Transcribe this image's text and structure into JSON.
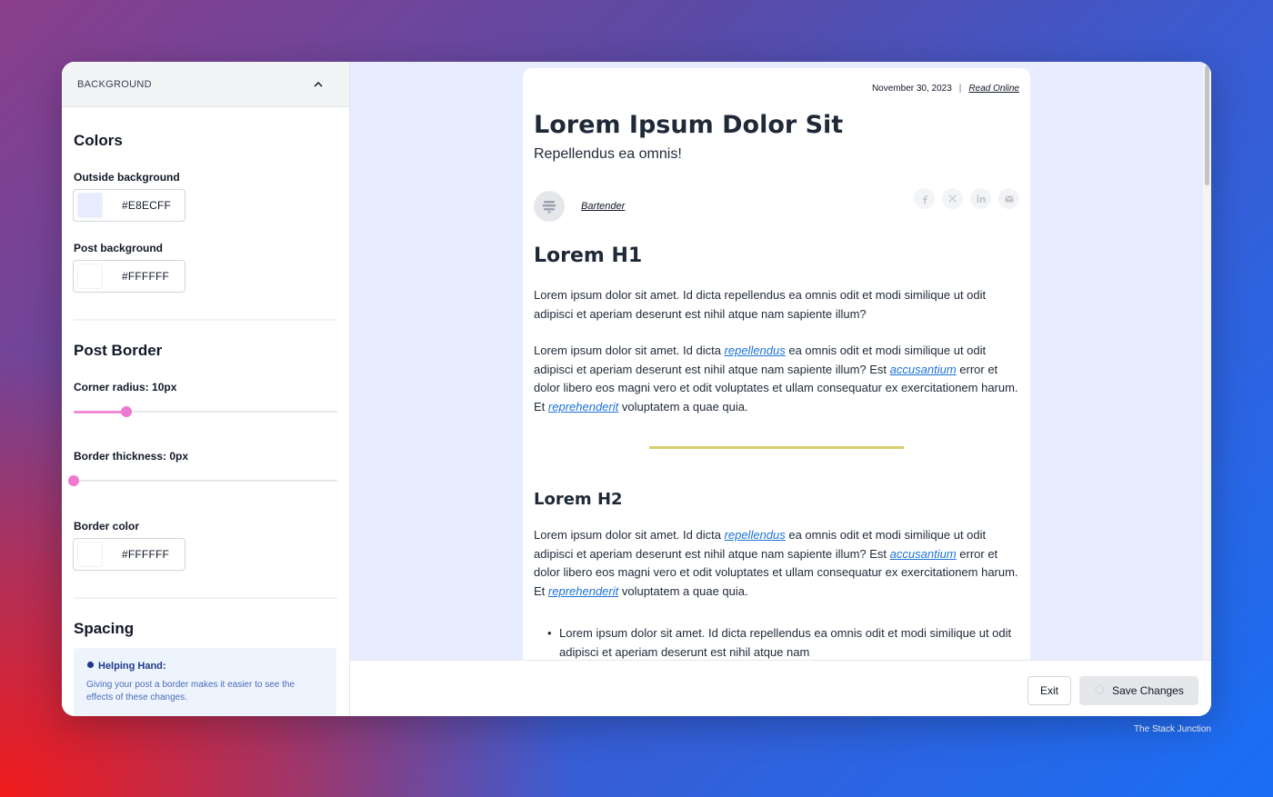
{
  "sidebar": {
    "section_label": "BACKGROUND",
    "colors": {
      "title": "Colors",
      "outside_label": "Outside background",
      "outside_value": "#E8ECFF",
      "post_label": "Post background",
      "post_value": "#FFFFFF"
    },
    "border": {
      "title": "Post Border",
      "radius_label": "Corner radius: 10px",
      "radius_fraction": 0.2,
      "thickness_label": "Border thickness: 0px",
      "thickness_fraction": 0.0,
      "color_label": "Border color",
      "color_value": "#FFFFFF"
    },
    "spacing": {
      "title": "Spacing",
      "helper_title": "Helping Hand:",
      "helper_text": "Giving your post a border makes it easier to see the effects of these changes."
    }
  },
  "post": {
    "date": "November 30, 2023",
    "separator": "|",
    "read_online": "Read Online",
    "title": "Lorem Ipsum Dolor Sit",
    "subtitle": "Repellendus ea omnis!",
    "author": "Bartender",
    "h1": "Lorem H1",
    "para1": "Lorem ipsum dolor sit amet. Id dicta repellendus ea omnis odit et modi similique ut odit adipisci et aperiam deserunt est nihil atque nam sapiente illum?",
    "para2": {
      "t1": "Lorem ipsum dolor sit amet. Id dicta ",
      "l1": "repellendus",
      "t2": " ea omnis odit et modi similique ut odit adipisci et aperiam deserunt est nihil atque nam sapiente illum? Est ",
      "l2": "accusantium",
      "t3": " error et dolor libero eos magni vero et odit voluptates et ullam consequatur ex exercitationem harum. Et ",
      "l3": "reprehenderit",
      "t4": " voluptatem a quae quia."
    },
    "h2": "Lorem H2",
    "bullet": "Lorem ipsum dolor sit amet. Id dicta repellendus ea omnis odit et modi similique ut odit adipisci et aperiam deserunt est nihil atque nam"
  },
  "footer": {
    "exit_label": "Exit",
    "save_label": "Save Changes"
  },
  "credit": "The Stack Junction",
  "colors": {
    "preview_bg": "#E8ECFF",
    "slider_accent": "#EE7AD0",
    "link": "#1D72D6",
    "divider_line": "#D7CF6B"
  },
  "icons": {
    "collapse": "chevron-up-icon",
    "socials": [
      "facebook-icon",
      "x-icon",
      "linkedin-icon",
      "mail-icon"
    ],
    "helper": "helping-hand-icon",
    "save": "spinner-icon"
  }
}
